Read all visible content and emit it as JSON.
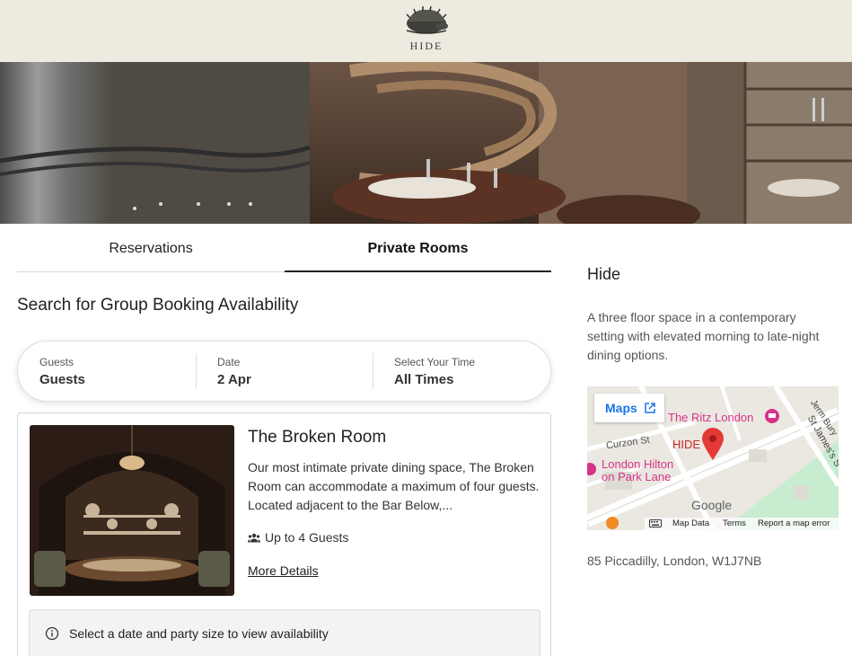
{
  "header": {
    "brand": "HIDE"
  },
  "hero": {
    "slide_count": 5,
    "active_slide": 1
  },
  "tabs": [
    {
      "label": "Reservations",
      "active": false
    },
    {
      "label": "Private Rooms",
      "active": true
    }
  ],
  "search": {
    "title": "Search for Group Booking Availability",
    "guests": {
      "label": "Guests",
      "value": "Guests"
    },
    "date": {
      "label": "Date",
      "value": "2 Apr"
    },
    "time": {
      "label": "Select Your Time",
      "value": "All Times"
    }
  },
  "room": {
    "title": "The Broken Room",
    "description": "Our most intimate private dining space, The Broken Room can accommodate a maximum of four guests. Located adjacent to the Bar Below,...",
    "capacity": "Up to 4 Guests",
    "more_details": "More Details",
    "availability_notice": "Select a date and party size to view availability"
  },
  "venue": {
    "name": "Hide",
    "description": "A three floor space in a contemporary setting with elevated morning to late-night dining options.",
    "address": "85 Piccadilly, London, W1J7NB"
  },
  "map": {
    "maps_button": "Maps",
    "labels": {
      "ritz": "The Ritz London",
      "hide": "HIDE",
      "hilton_1": "London Hilton",
      "hilton_2": "on Park Lane",
      "curzon": "Curzon St",
      "st_james": "St James's S",
      "jermyn": "Jerm",
      "bury": "Bury",
      "google": "Google"
    },
    "footer": {
      "map_data": "Map Data",
      "terms": "Terms",
      "report": "Report a map error"
    }
  },
  "colors": {
    "header_bg": "#edeae0",
    "link_blue": "#1a73e8",
    "poi_pink": "#d6338a",
    "pin_red": "#e53935"
  }
}
